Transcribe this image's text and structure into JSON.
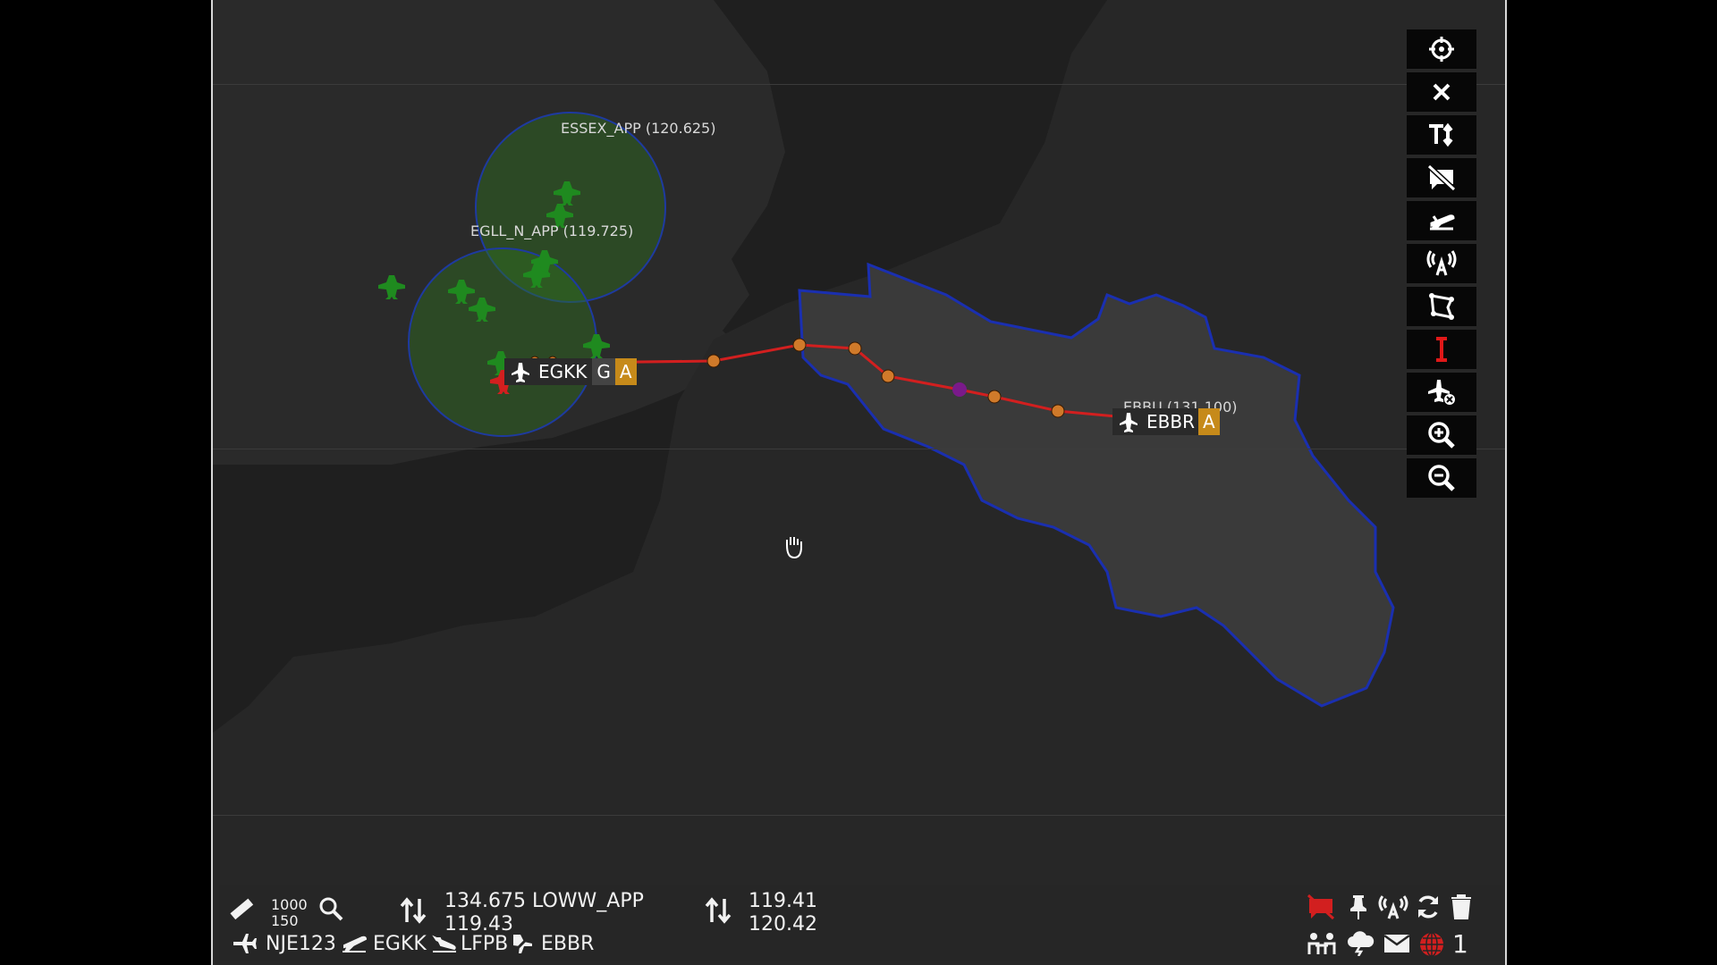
{
  "map": {
    "sectors": [
      {
        "label": "ESSEX_APP (120.625)"
      },
      {
        "label": "EGLL_N_APP (119.725)"
      },
      {
        "label": "EBBU (131.100)"
      }
    ],
    "departure_tag": {
      "callsign": "EGKK",
      "letters": [
        "G",
        "A"
      ]
    },
    "arrival_tag": {
      "callsign": "EBBR",
      "letters": [
        "A"
      ]
    },
    "colors": {
      "route": "#d21f1f",
      "waypoint": "#d07a2a",
      "sector_fill": "#2f6e1e",
      "sector_border": "#1e3aa0",
      "country_border": "#1a2fb0",
      "traffic": "#1f8a1f",
      "tag_accent": "#c68a1a"
    }
  },
  "toolbar": {
    "buttons": [
      {
        "name": "center-icon"
      },
      {
        "name": "close-icon"
      },
      {
        "name": "text-size-icon"
      },
      {
        "name": "hide-labels-icon"
      },
      {
        "name": "departure-icon"
      },
      {
        "name": "atc-antenna-icon"
      },
      {
        "name": "map-area-icon"
      },
      {
        "name": "cursor-icon"
      },
      {
        "name": "remove-aircraft-icon"
      },
      {
        "name": "zoom-in-icon"
      },
      {
        "name": "zoom-out-icon"
      }
    ]
  },
  "bottom_bar": {
    "altitude_top": "1000",
    "altitude_bottom": "150",
    "com1_active": "134.675 LOWW_APP",
    "com1_standby": "119.43",
    "com2_active": "119.41",
    "com2_standby": "120.42",
    "callsign": "NJE123",
    "departure": "EGKK",
    "alternate": "LFPB",
    "arrival": "EBBR",
    "notification_count": "1"
  }
}
